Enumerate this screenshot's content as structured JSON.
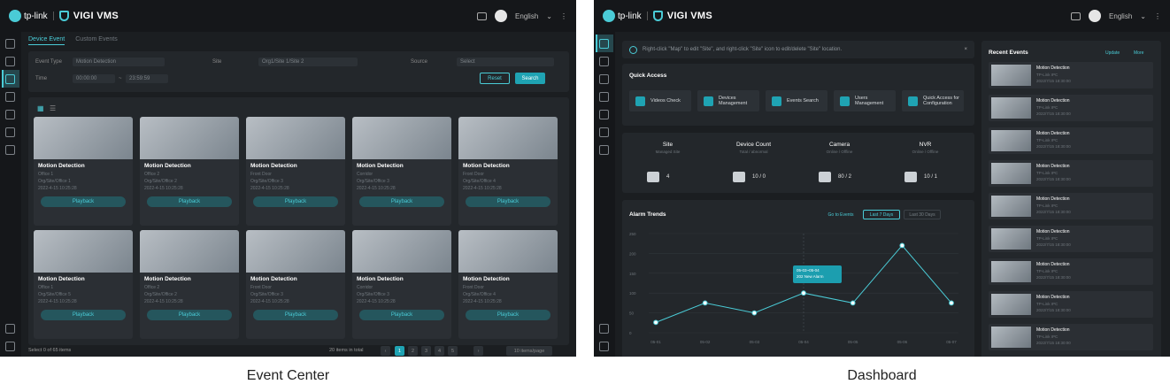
{
  "app": {
    "brand": "tp-link",
    "product": "VIGI VMS",
    "language": "English"
  },
  "event_center": {
    "caption": "Event Center",
    "tabs": [
      "Device Event",
      "Custom Events"
    ],
    "filters": {
      "event_type_label": "Event Type",
      "event_type_value": "Motion Detection",
      "site_label": "Site",
      "site_value": "Org1/Site 1/Site 2",
      "source_label": "Source",
      "source_value": "Select",
      "time_label": "Time",
      "time_start": "00:00:00",
      "time_end": "23:59:59",
      "reset": "Reset",
      "search": "Search"
    },
    "cards": [
      {
        "title": "Motion Detection",
        "site": "Office 1",
        "device": "Org/Site/Office 1",
        "time": "2022-4-15 10:25:28",
        "action": "Playback"
      },
      {
        "title": "Motion Detection",
        "site": "Office 2",
        "device": "Org/Site/Office 2",
        "time": "2022-4-15 10:25:28",
        "action": "Playback"
      },
      {
        "title": "Motion Detection",
        "site": "Front Door",
        "device": "Org/Site/Office 3",
        "time": "2022-4-15 10:25:28",
        "action": "Playback"
      },
      {
        "title": "Motion Detection",
        "site": "Corridor",
        "device": "Org/Site/Office 3",
        "time": "2022-4-15 10:25:28",
        "action": "Playback"
      },
      {
        "title": "Motion Detection",
        "site": "Front Door",
        "device": "Org/Site/Office 4",
        "time": "2022-4-15 10:25:28",
        "action": "Playback"
      },
      {
        "title": "Motion Detection",
        "site": "Office 1",
        "device": "Org/Site/Office 5",
        "time": "2022-4-15 10:25:28",
        "action": "Playback"
      },
      {
        "title": "Motion Detection",
        "site": "Office 2",
        "device": "Org/Site/Office 2",
        "time": "2022-4-15 10:25:28",
        "action": "Playback"
      },
      {
        "title": "Motion Detection",
        "site": "Front Door",
        "device": "Org/Site/Office 3",
        "time": "2022-4-15 10:25:28",
        "action": "Playback"
      },
      {
        "title": "Motion Detection",
        "site": "Corridor",
        "device": "Org/Site/Office 3",
        "time": "2022-4-15 10:25:28",
        "action": "Playback"
      },
      {
        "title": "Motion Detection",
        "site": "Front Door",
        "device": "Org/Site/Office 4",
        "time": "2022-4-15 10:25:28",
        "action": "Playback"
      }
    ],
    "footer": {
      "selected": "Select 0 of 65 items",
      "total": "20 items in total",
      "pages": [
        "1",
        "2",
        "3",
        "4",
        "5"
      ],
      "per_page": "10 items/page"
    }
  },
  "dashboard": {
    "caption": "Dashboard",
    "notice": "Right-click \"Map\" to edit \"Site\", and right-click \"Site\" icon to edit/delete \"Site\" location.",
    "quick_access": {
      "title": "Quick Access",
      "items": [
        "Videos Check",
        "Devices Management",
        "Events Search",
        "Users Management",
        "Quick Access for Configuration"
      ]
    },
    "stats": [
      {
        "title": "Site",
        "sub": "Managed Site",
        "value": "4"
      },
      {
        "title": "Device Count",
        "sub": "Total / abnormal",
        "value": "10 / 0"
      },
      {
        "title": "Camera",
        "sub": "Online / Offline",
        "value": "80 / 2"
      },
      {
        "title": "NVR",
        "sub": "Online / Offline",
        "value": "10 / 1"
      }
    ],
    "alarm": {
      "title": "Alarm Trends",
      "tabs": [
        "Go to Events",
        "Last 7 Days",
        "Last 30 Days"
      ],
      "tooltip_date": "05-03~05-04",
      "tooltip_value": "202 New Alarm"
    },
    "chart_data": {
      "type": "line",
      "title": "Alarm Trends",
      "categories": [
        "05-01",
        "05-02",
        "05-03",
        "05-04",
        "05-05",
        "05-06",
        "05-07"
      ],
      "values": [
        26,
        75,
        50,
        100,
        75,
        220,
        75
      ],
      "ylim": [
        0,
        250
      ],
      "yticks": [
        "0",
        "50",
        "100",
        "150",
        "200",
        "250"
      ],
      "color": "#4acbd6"
    },
    "recent": {
      "title": "Recent Events",
      "more": "Update",
      "all": "More",
      "items": [
        {
          "name": "Motion Detection",
          "source": "TP-Link IPC",
          "time": "2022/7/15 18:30:00"
        },
        {
          "name": "Motion Detection",
          "source": "TP-Link IPC",
          "time": "2022/7/15 18:30:00"
        },
        {
          "name": "Motion Detection",
          "source": "TP-Link IPC",
          "time": "2022/7/15 18:30:00"
        },
        {
          "name": "Motion Detection",
          "source": "TP-Link IPC",
          "time": "2022/7/15 18:30:00"
        },
        {
          "name": "Motion Detection",
          "source": "TP-Link IPC",
          "time": "2022/7/15 18:30:00"
        },
        {
          "name": "Motion Detection",
          "source": "TP-Link IPC",
          "time": "2022/7/15 18:30:00"
        },
        {
          "name": "Motion Detection",
          "source": "TP-Link IPC",
          "time": "2022/7/15 18:30:00"
        },
        {
          "name": "Motion Detection",
          "source": "TP-Link IPC",
          "time": "2022/7/15 18:30:00"
        },
        {
          "name": "Motion Detection",
          "source": "TP-Link IPC",
          "time": "2022/7/15 18:30:00"
        }
      ]
    }
  }
}
